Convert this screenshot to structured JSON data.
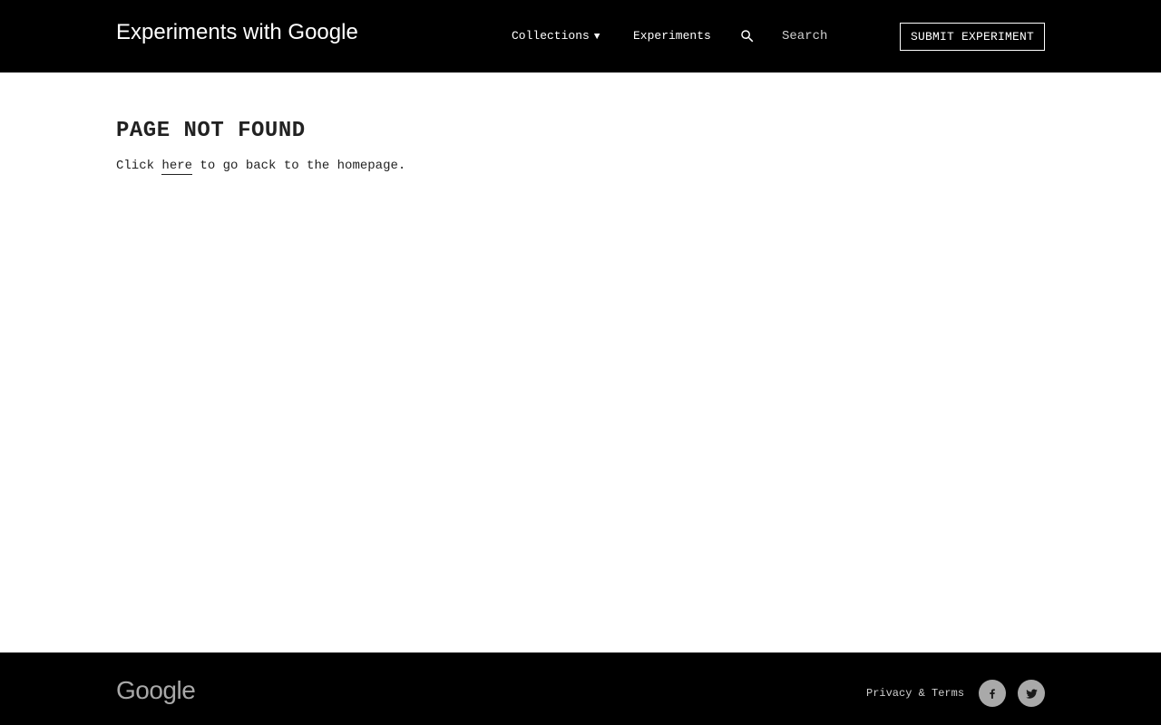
{
  "header": {
    "brand": "Experiments with Google",
    "nav": {
      "collections_label": "Collections",
      "collections_caret": "▼",
      "experiments_label": "Experiments"
    },
    "search": {
      "placeholder": "Search",
      "icon": "search-icon"
    },
    "submit_label": "SUBMIT EXPERIMENT"
  },
  "main": {
    "title": "PAGE NOT FOUND",
    "message_before": "Click ",
    "link_text": "here",
    "message_after": " to go back to the homepage."
  },
  "footer": {
    "logo_text": "Google",
    "privacy_label": "Privacy & Terms",
    "social": [
      "facebook-icon",
      "twitter-icon"
    ]
  },
  "colors": {
    "header_bg": "#000000",
    "footer_bg": "#000000",
    "text": "#222222",
    "logo_gray": "#a8a8a8",
    "social_bg": "#a9a9a9"
  }
}
